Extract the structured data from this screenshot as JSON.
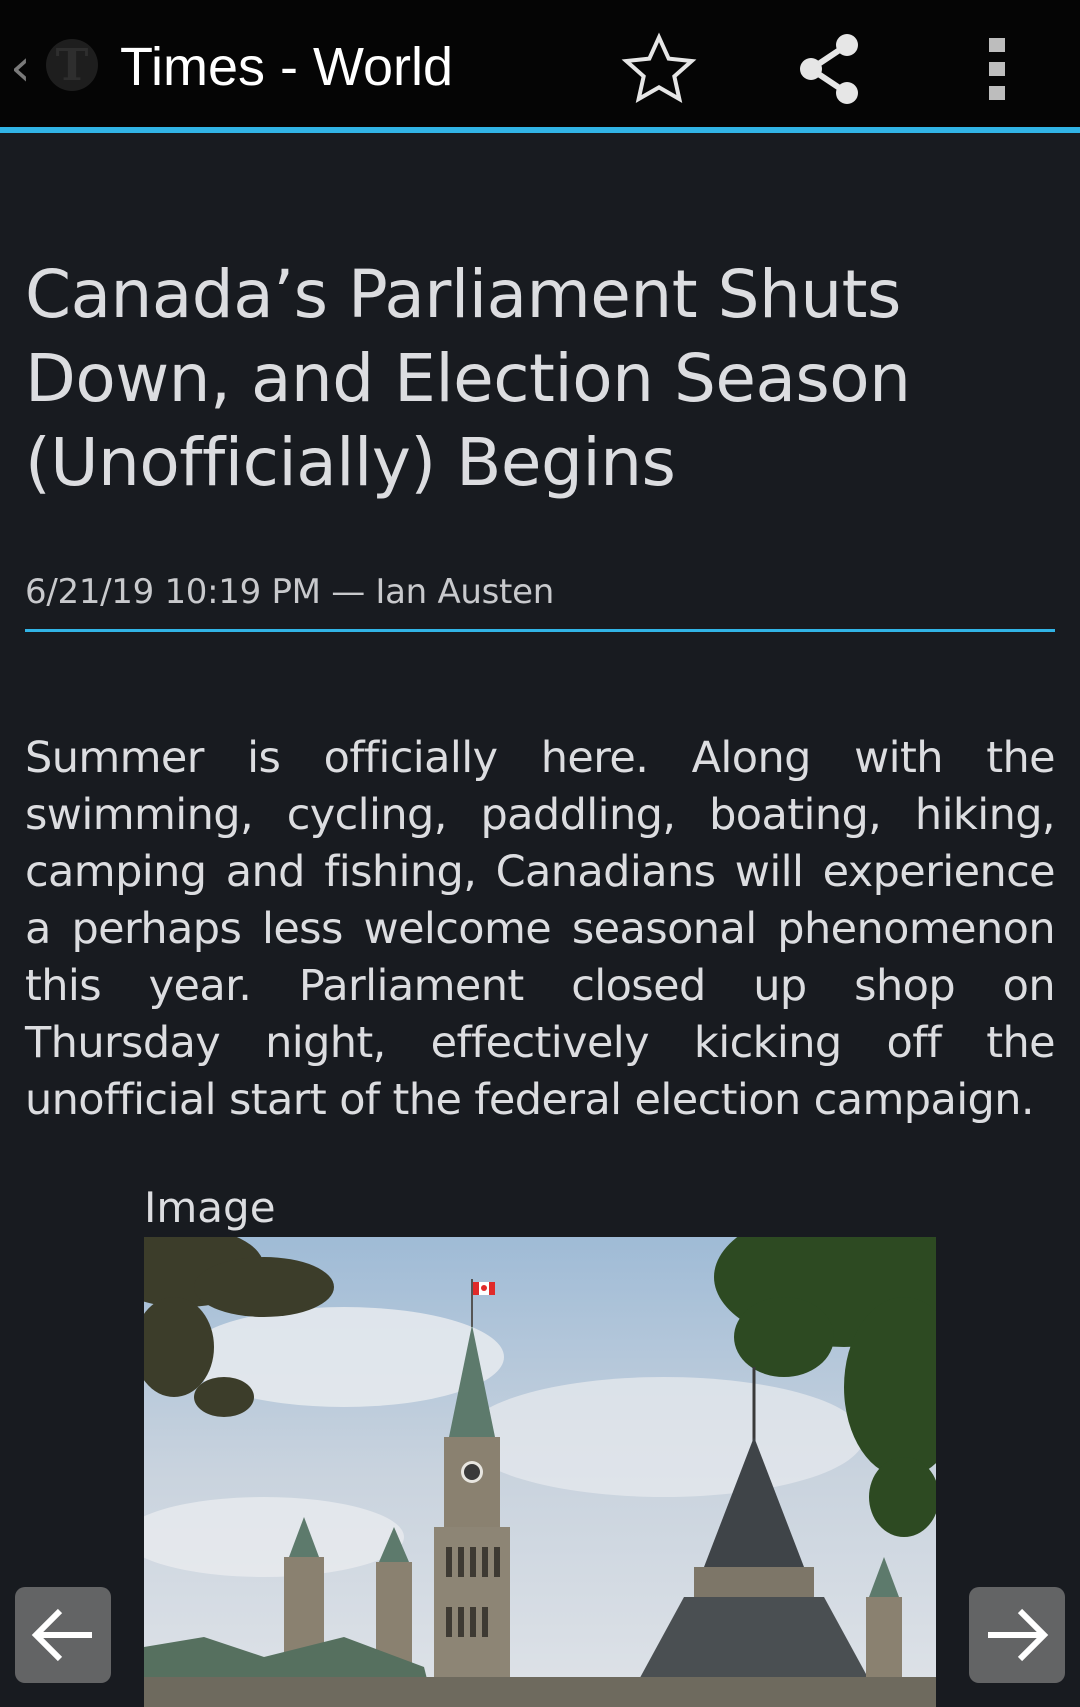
{
  "toolbar": {
    "title": "Times - World",
    "back_icon": "chevron-left-icon",
    "logo_icon": "nyt-logo-icon",
    "actions": [
      {
        "name": "star-icon"
      },
      {
        "name": "share-icon"
      },
      {
        "name": "overflow-menu-icon"
      }
    ],
    "accent_color": "#31b4e6"
  },
  "article": {
    "headline": "Canada’s Parliament Shuts Down, and Election Season (Unofficially) Begins",
    "meta": "6/21/19 10:19 PM — Ian Austen",
    "body": "Summer is officially here. Along with the swimming, cycling, paddling, boating, hiking, camping and fishing, Canadians will experience a perhaps less welcome seasonal phenomenon this year. Parliament closed up shop on Thursday night, effectively kicking off the unofficial start of the federal election campaign.",
    "image_label": "Image"
  },
  "navigation": {
    "prev_icon": "arrow-left-icon",
    "next_icon": "arrow-right-icon"
  }
}
